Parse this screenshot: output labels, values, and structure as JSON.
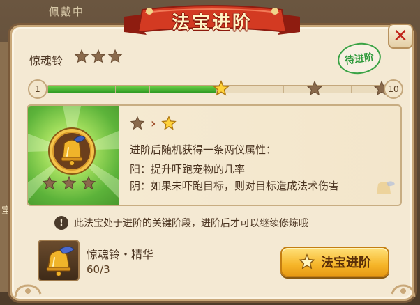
{
  "background": {
    "tab_label": "佩戴中",
    "side_char": "宝"
  },
  "dialog": {
    "title": "法宝进阶",
    "close_label": "✕"
  },
  "treasure": {
    "name": "惊魂铃",
    "current_stars": 3,
    "status_stamp": "待进阶"
  },
  "progress": {
    "start": "1",
    "end": "10",
    "current_level": 4,
    "fill_fraction": 0.5
  },
  "upgrade": {
    "effect_title": "进阶后随机获得一条两仪属性：",
    "yang_line": "阳：提升吓跑宠物的几率",
    "yin_line": "阴：如果未吓跑目标，则对目标造成法术伤害"
  },
  "notice": {
    "icon": "!",
    "text": "此法宝处于进阶的关键阶段，进阶后才可以继续修炼哦"
  },
  "material": {
    "name": "惊魂铃・精华",
    "count": "60/3"
  },
  "action": {
    "button_label": "法宝进阶"
  },
  "colors": {
    "ribbon": "#c8321f",
    "progress_fill": "#3fae2a",
    "button": "#f6b62a",
    "stamp": "#3aa345"
  }
}
